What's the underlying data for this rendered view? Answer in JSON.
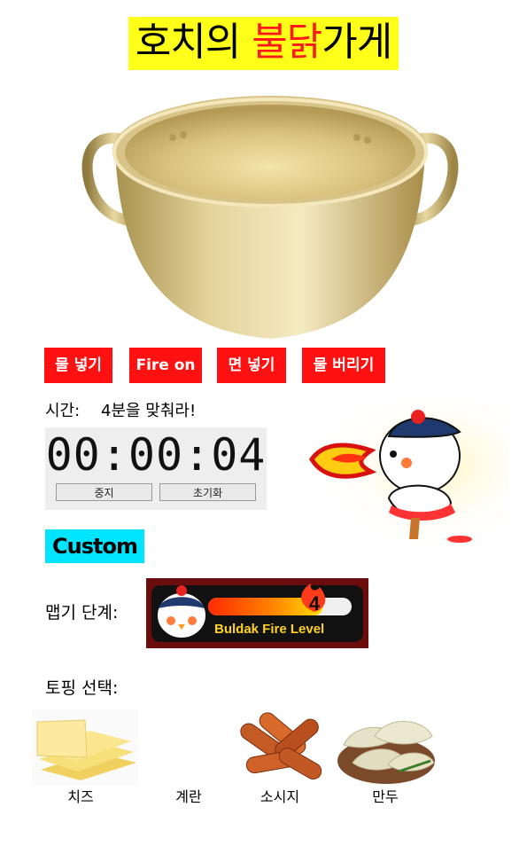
{
  "title": {
    "part1": "호치의 ",
    "highlight": "불닭",
    "part2": "가게"
  },
  "buttons": [
    "물 넣기",
    "Fire on",
    "면 넣기",
    "물 버리기"
  ],
  "timer": {
    "label": "시간:",
    "goal": "4분을 맞춰라!",
    "display": "00:00:04",
    "stop_label": "중지",
    "reset_label": "초기화"
  },
  "custom": {
    "label": "Custom"
  },
  "spicy": {
    "label": "맵기 단계:",
    "level": "4",
    "badge_text": "Buldak Fire Level",
    "level_fraction": 0.8
  },
  "toppings": {
    "label": "토핑 선택:",
    "items": [
      {
        "name": "치즈"
      },
      {
        "name": "계란"
      },
      {
        "name": "소시지"
      },
      {
        "name": "만두"
      }
    ]
  },
  "colors": {
    "title_bg": "#ffff19",
    "accent_red": "#ff1111",
    "custom_bg": "#00e5ff",
    "timer_bg": "#eeeeee"
  }
}
